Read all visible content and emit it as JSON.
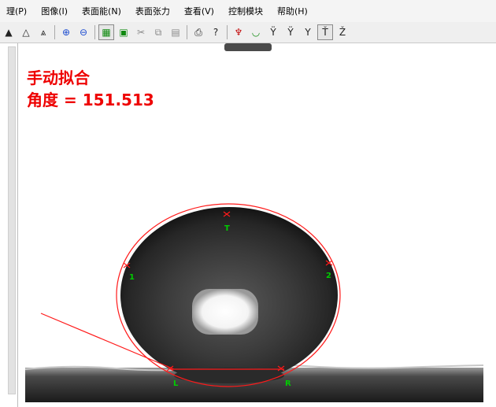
{
  "menu": [
    "理(P)",
    "图像(I)",
    "表面能(N)",
    "表面张力",
    "查看(V)",
    "控制模块",
    "帮助(H)"
  ],
  "overlay": {
    "mode_label": "手动拟合",
    "angle_label": "角度",
    "equals": "=",
    "angle_value": "151.513"
  },
  "markers": {
    "top": "T",
    "point1": "1",
    "point2": "2",
    "left": "L",
    "right": "R"
  },
  "colors": {
    "overlay_text": "#ee0000",
    "fit_curve": "#ff1a1a",
    "marker_labels": "#00cc00"
  }
}
